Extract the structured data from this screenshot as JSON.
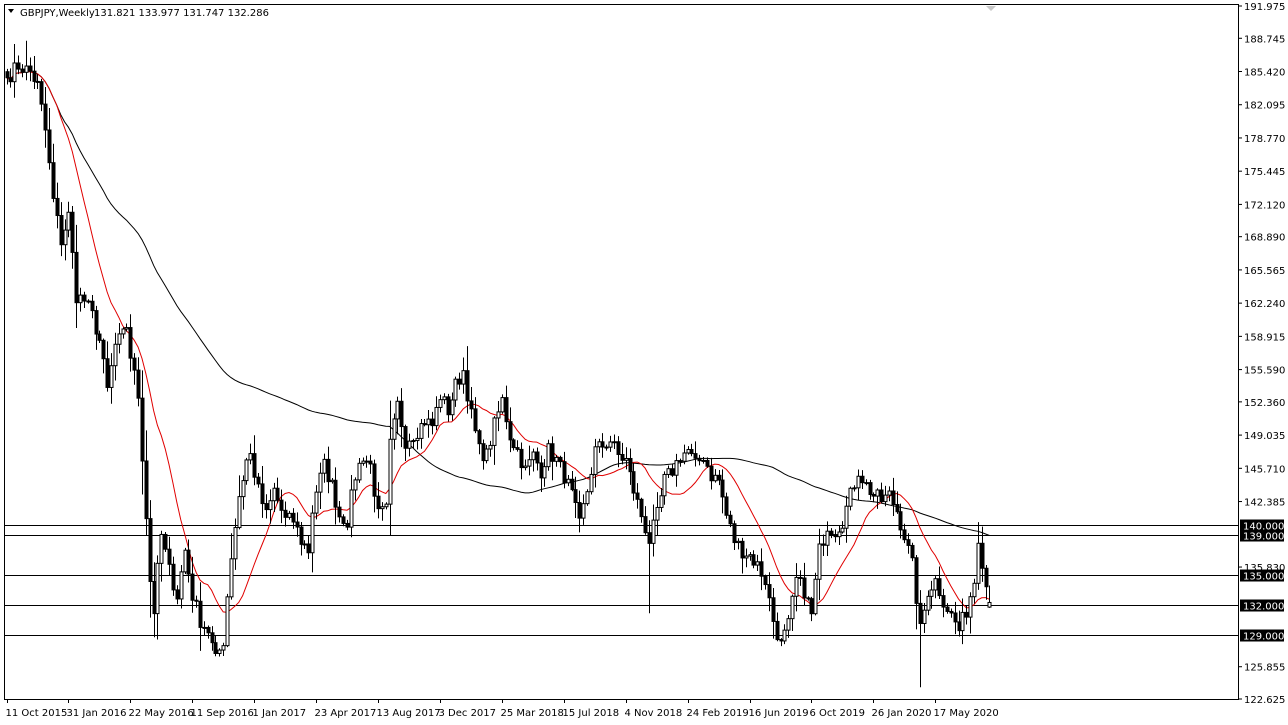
{
  "header": {
    "symbol": "GBPJPY,Weekly",
    "ohlc": "131.821 133.977 131.747 132.286",
    "menu_icon": "triangle-down-icon"
  },
  "colors": {
    "background": "#ffffff",
    "frame": "#000000",
    "candle_up": "#ffffff",
    "candle_down": "#000000",
    "ma_fast": "#e00000",
    "ma_slow": "#000000",
    "label_bg": "#000000",
    "label_text": "#ffffff"
  },
  "chart_data": {
    "type": "candlestick",
    "title": "GBPJPY,Weekly",
    "ylim": [
      122.625,
      191.975
    ],
    "grid": false,
    "y_ticks": [
      "191.975",
      "188.745",
      "185.420",
      "182.095",
      "178.770",
      "175.445",
      "172.120",
      "168.890",
      "165.565",
      "162.240",
      "158.915",
      "155.590",
      "152.360",
      "149.035",
      "145.710",
      "142.385",
      "135.830",
      "125.855",
      "122.625"
    ],
    "x_ticks": [
      "11 Oct 2015",
      "31 Jan 2016",
      "22 May 2016",
      "11 Sep 2016",
      "1 Jan 2017",
      "23 Apr 2017",
      "13 Aug 2017",
      "3 Dec 2017",
      "25 Mar 2018",
      "15 Jul 2018",
      "4 Nov 2018",
      "24 Feb 2019",
      "16 Jun 2019",
      "6 Oct 2019",
      "26 Jan 2020",
      "17 May 2020"
    ],
    "x_tick_index": [
      0,
      16,
      32,
      48,
      64,
      80,
      96,
      112,
      128,
      144,
      160,
      176,
      192,
      208,
      224,
      240
    ],
    "horizontal_levels": [
      {
        "value": 140.0,
        "label": "140.000"
      },
      {
        "value": 139.0,
        "label": "139.000"
      },
      {
        "value": 135.0,
        "label": "135.000"
      },
      {
        "value": 132.0,
        "label": "132.000"
      },
      {
        "value": 129.0,
        "label": "129.000"
      }
    ],
    "anchor_closes": [
      [
        0,
        184.8
      ],
      [
        3,
        186.0
      ],
      [
        6,
        185.4
      ],
      [
        8,
        184.0
      ],
      [
        10,
        179.5
      ],
      [
        12,
        172.5
      ],
      [
        14,
        168.5
      ],
      [
        16,
        171.0
      ],
      [
        18,
        163.0
      ],
      [
        20,
        162.5
      ],
      [
        22,
        161.0
      ],
      [
        24,
        158.5
      ],
      [
        26,
        153.5
      ],
      [
        28,
        158.0
      ],
      [
        30,
        159.0
      ],
      [
        31,
        160.0
      ],
      [
        32,
        157.0
      ],
      [
        34,
        153.0
      ],
      [
        36,
        141.0
      ],
      [
        37,
        134.5
      ],
      [
        38,
        131.5
      ],
      [
        39,
        135.5
      ],
      [
        40,
        139.0
      ],
      [
        42,
        135.5
      ],
      [
        44,
        133.0
      ],
      [
        46,
        137.5
      ],
      [
        48,
        133.0
      ],
      [
        50,
        130.5
      ],
      [
        52,
        129.5
      ],
      [
        54,
        126.5
      ],
      [
        56,
        128.5
      ],
      [
        57,
        133.0
      ],
      [
        58,
        137.0
      ],
      [
        60,
        143.0
      ],
      [
        62,
        146.5
      ],
      [
        63,
        147.0
      ],
      [
        65,
        143.5
      ],
      [
        67,
        141.0
      ],
      [
        69,
        143.5
      ],
      [
        72,
        140.5
      ],
      [
        74,
        140.5
      ],
      [
        76,
        138.5
      ],
      [
        78,
        137.5
      ],
      [
        79,
        141.5
      ],
      [
        80,
        143.5
      ],
      [
        82,
        146.0
      ],
      [
        84,
        144.0
      ],
      [
        86,
        141.0
      ],
      [
        88,
        140.5
      ],
      [
        90,
        145.0
      ],
      [
        92,
        147.0
      ],
      [
        94,
        146.0
      ],
      [
        96,
        141.0
      ],
      [
        98,
        141.5
      ],
      [
        99,
        148.0
      ],
      [
        101,
        152.0
      ],
      [
        103,
        148.5
      ],
      [
        106,
        149.5
      ],
      [
        108,
        150.5
      ],
      [
        110,
        150.0
      ],
      [
        112,
        153.0
      ],
      [
        114,
        151.5
      ],
      [
        116,
        154.0
      ],
      [
        118,
        155.5
      ],
      [
        120,
        151.0
      ],
      [
        122,
        147.5
      ],
      [
        124,
        147.0
      ],
      [
        126,
        150.0
      ],
      [
        128,
        152.5
      ],
      [
        130,
        149.0
      ],
      [
        132,
        147.5
      ],
      [
        134,
        145.5
      ],
      [
        136,
        147.0
      ],
      [
        138,
        145.5
      ],
      [
        140,
        147.5
      ],
      [
        142,
        146.5
      ],
      [
        144,
        145.0
      ],
      [
        146,
        143.0
      ],
      [
        148,
        140.0
      ],
      [
        150,
        143.5
      ],
      [
        152,
        147.5
      ],
      [
        154,
        148.0
      ],
      [
        156,
        148.5
      ],
      [
        158,
        147.0
      ],
      [
        160,
        146.5
      ],
      [
        162,
        143.5
      ],
      [
        164,
        141.0
      ],
      [
        166,
        138.5
      ],
      [
        168,
        141.0
      ],
      [
        170,
        144.5
      ],
      [
        172,
        145.5
      ],
      [
        174,
        147.0
      ],
      [
        176,
        147.5
      ],
      [
        178,
        146.0
      ],
      [
        180,
        147.0
      ],
      [
        182,
        145.0
      ],
      [
        184,
        144.5
      ],
      [
        186,
        141.0
      ],
      [
        188,
        138.5
      ],
      [
        190,
        137.5
      ],
      [
        192,
        137.0
      ],
      [
        194,
        136.0
      ],
      [
        196,
        134.5
      ],
      [
        198,
        130.5
      ],
      [
        200,
        128.0
      ],
      [
        202,
        130.0
      ],
      [
        204,
        134.5
      ],
      [
        206,
        133.5
      ],
      [
        208,
        131.0
      ],
      [
        210,
        137.5
      ],
      [
        212,
        140.0
      ],
      [
        214,
        139.5
      ],
      [
        216,
        140.5
      ],
      [
        218,
        143.0
      ],
      [
        220,
        145.5
      ],
      [
        222,
        144.0
      ],
      [
        224,
        143.0
      ],
      [
        226,
        142.5
      ],
      [
        228,
        143.0
      ],
      [
        230,
        141.5
      ],
      [
        232,
        139.0
      ],
      [
        234,
        136.0
      ],
      [
        236,
        129.5
      ],
      [
        238,
        133.5
      ],
      [
        240,
        134.5
      ],
      [
        242,
        132.5
      ],
      [
        244,
        131.0
      ],
      [
        246,
        129.5
      ],
      [
        248,
        131.5
      ],
      [
        250,
        134.5
      ],
      [
        251,
        139.0
      ],
      [
        252,
        136.5
      ],
      [
        253,
        134.0
      ],
      [
        254,
        132.3
      ]
    ],
    "series": []
  }
}
